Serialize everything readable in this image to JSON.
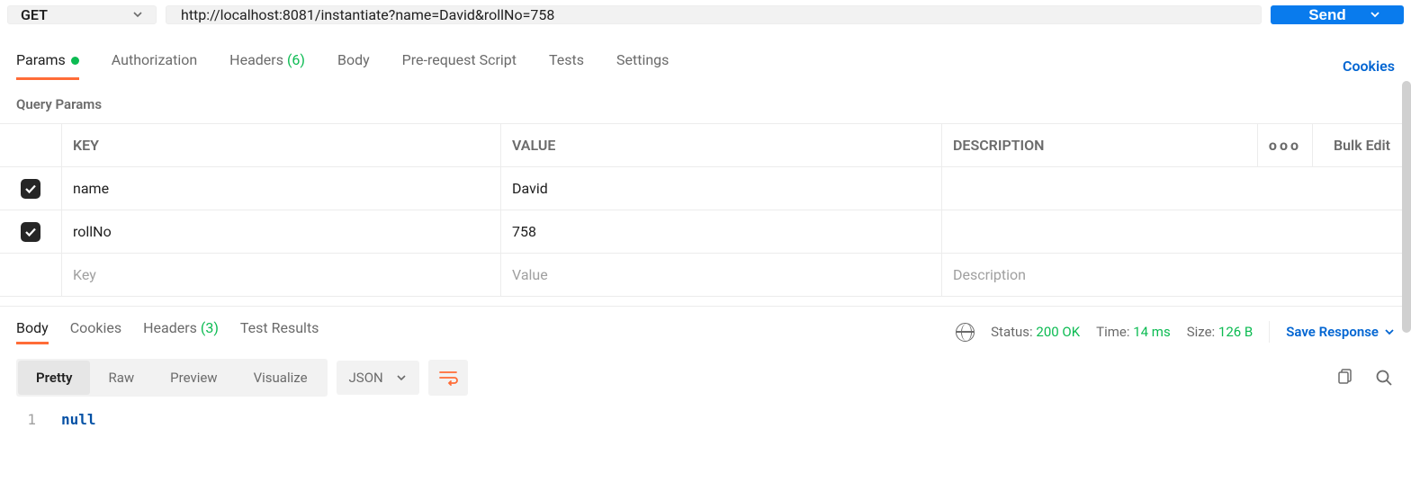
{
  "request": {
    "method": "GET",
    "url": "http://localhost:8081/instantiate?name=David&rollNo=758",
    "send_label": "Send"
  },
  "tabs": {
    "params": "Params",
    "authorization": "Authorization",
    "headers": "Headers",
    "headers_count": "(6)",
    "body": "Body",
    "prerequest": "Pre-request Script",
    "tests": "Tests",
    "settings": "Settings",
    "cookies": "Cookies"
  },
  "section": {
    "title": "Query Params"
  },
  "table": {
    "col_key": "KEY",
    "col_value": "VALUE",
    "col_description": "DESCRIPTION",
    "more": "ooo",
    "bulk_edit": "Bulk Edit",
    "rows": [
      {
        "key": "name",
        "value": "David",
        "description": ""
      },
      {
        "key": "rollNo",
        "value": "758",
        "description": ""
      }
    ],
    "placeholder_key": "Key",
    "placeholder_value": "Value",
    "placeholder_description": "Description"
  },
  "response_tabs": {
    "body": "Body",
    "cookies": "Cookies",
    "headers": "Headers",
    "headers_count": "(3)",
    "test_results": "Test Results"
  },
  "response_meta": {
    "status_label": "Status:",
    "status_value": "200 OK",
    "time_label": "Time:",
    "time_value": "14 ms",
    "size_label": "Size:",
    "size_value": "126 B",
    "save_response": "Save Response"
  },
  "view_modes": {
    "pretty": "Pretty",
    "raw": "Raw",
    "preview": "Preview",
    "visualize": "Visualize",
    "format": "JSON"
  },
  "response_body": {
    "line_number": "1",
    "content": "null"
  }
}
